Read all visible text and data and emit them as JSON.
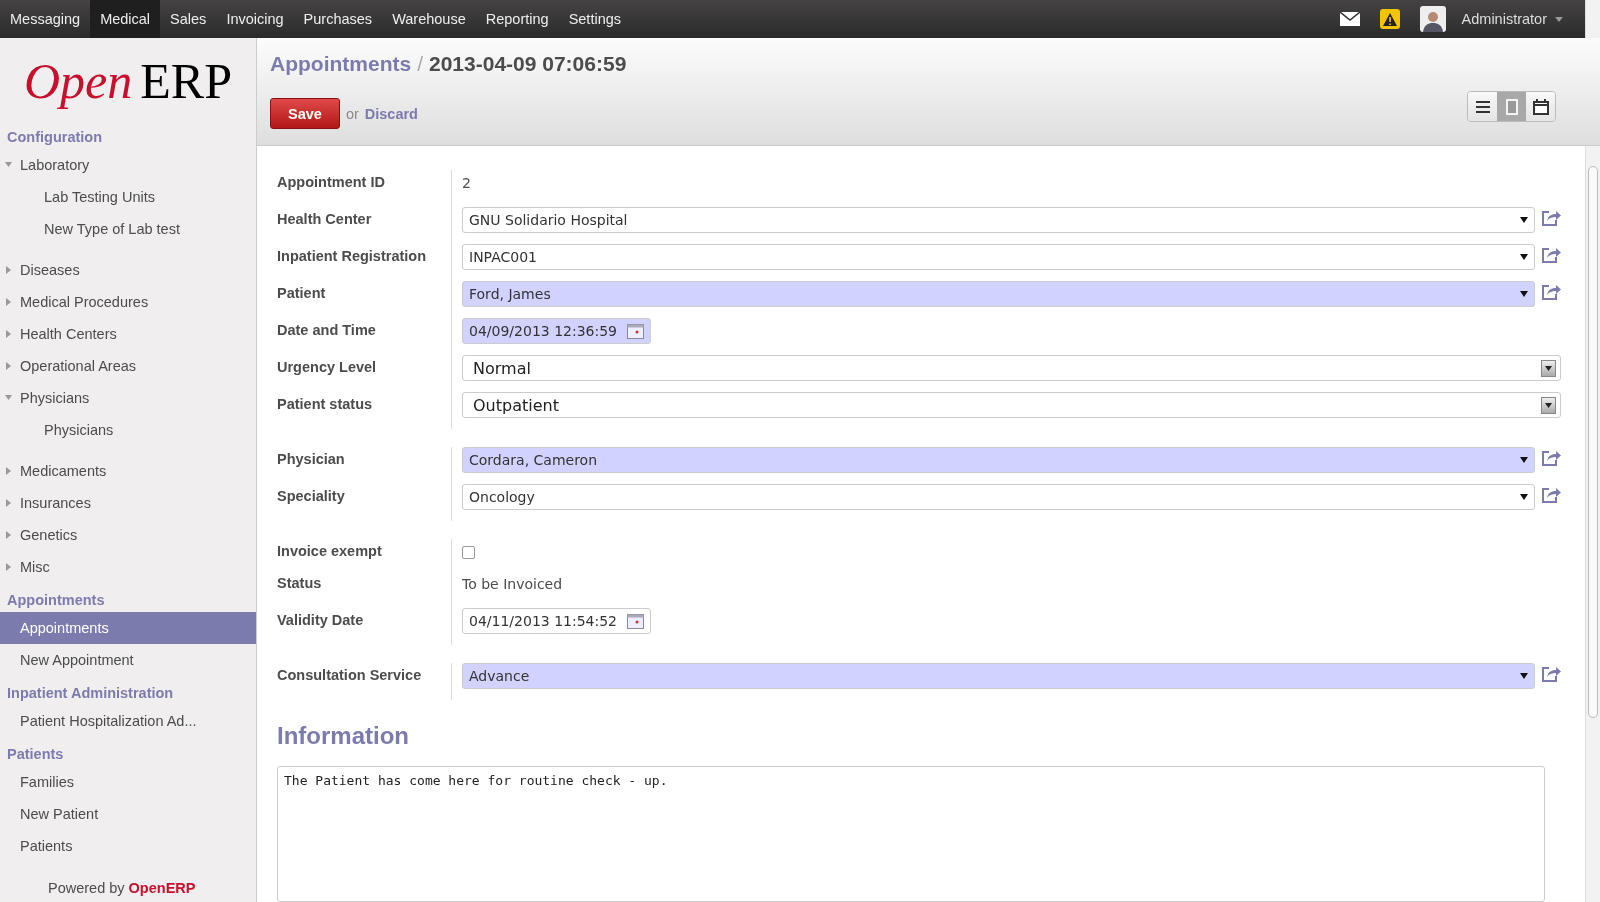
{
  "top_menu": [
    {
      "label": "Messaging",
      "selected": false
    },
    {
      "label": "Medical",
      "selected": true
    },
    {
      "label": "Sales",
      "selected": false
    },
    {
      "label": "Invoicing",
      "selected": false
    },
    {
      "label": "Purchases",
      "selected": false
    },
    {
      "label": "Warehouse",
      "selected": false
    },
    {
      "label": "Reporting",
      "selected": false
    },
    {
      "label": "Settings",
      "selected": false
    }
  ],
  "user": {
    "name": "Administrator"
  },
  "logo": {
    "open": "Open",
    "erp": "ERP"
  },
  "sidebar": {
    "sections": [
      {
        "title": "Configuration",
        "items": [
          {
            "label": "Laboratory",
            "expandable": true,
            "expanded": true,
            "selected": false,
            "children": [
              {
                "label": "Lab Testing Units",
                "selected": false
              },
              {
                "label": "New Type of Lab test",
                "selected": false
              }
            ]
          },
          {
            "label": "Diseases",
            "expandable": true,
            "expanded": false,
            "selected": false
          },
          {
            "label": "Medical Procedures",
            "expandable": true,
            "expanded": false,
            "selected": false
          },
          {
            "label": "Health Centers",
            "expandable": true,
            "expanded": false,
            "selected": false
          },
          {
            "label": "Operational Areas",
            "expandable": true,
            "expanded": false,
            "selected": false
          },
          {
            "label": "Physicians",
            "expandable": true,
            "expanded": true,
            "selected": false,
            "children": [
              {
                "label": "Physicians",
                "selected": false
              }
            ]
          },
          {
            "label": "Medicaments",
            "expandable": true,
            "expanded": false,
            "selected": false
          },
          {
            "label": "Insurances",
            "expandable": true,
            "expanded": false,
            "selected": false
          },
          {
            "label": "Genetics",
            "expandable": true,
            "expanded": false,
            "selected": false
          },
          {
            "label": "Misc",
            "expandable": true,
            "expanded": false,
            "selected": false
          }
        ]
      },
      {
        "title": "Appointments",
        "items": [
          {
            "label": "Appointments",
            "expandable": false,
            "selected": true
          },
          {
            "label": "New Appointment",
            "expandable": false,
            "selected": false
          }
        ]
      },
      {
        "title": "Inpatient Administration",
        "items": [
          {
            "label": "Patient Hospitalization Ad...",
            "expandable": false,
            "selected": false
          }
        ]
      },
      {
        "title": "Patients",
        "items": [
          {
            "label": "Families",
            "expandable": false,
            "selected": false
          },
          {
            "label": "New Patient",
            "expandable": false,
            "selected": false
          },
          {
            "label": "Patients",
            "expandable": false,
            "selected": false
          }
        ]
      }
    ],
    "footer": {
      "prefix": "Powered by",
      "brand": "OpenERP"
    }
  },
  "breadcrumb": {
    "parent": "Appointments",
    "separator": "/",
    "current": "2013-04-09 07:06:59"
  },
  "actions": {
    "save": "Save",
    "or": "or",
    "discard": "Discard"
  },
  "views": [
    {
      "kind": "list",
      "selected": false
    },
    {
      "kind": "form",
      "selected": true
    },
    {
      "kind": "calendar",
      "selected": false
    }
  ],
  "form_groups": [
    [
      {
        "label": "Appointment ID",
        "kind": "text",
        "value": "2"
      },
      {
        "label": "Health Center",
        "kind": "many2one",
        "value": "GNU Solidario Hospital",
        "required": false
      },
      {
        "label": "Inpatient Registration",
        "kind": "many2one",
        "value": "INPAC001",
        "required": false
      },
      {
        "label": "Patient",
        "kind": "many2one",
        "value": "Ford, James",
        "required": true
      },
      {
        "label": "Date and Time",
        "kind": "date",
        "value": "04/09/2013 12:36:59",
        "required": true
      },
      {
        "label": "Urgency Level",
        "kind": "select",
        "value": "Normal"
      },
      {
        "label": "Patient status",
        "kind": "select",
        "value": "Outpatient"
      }
    ],
    [
      {
        "label": "Physician",
        "kind": "many2one",
        "value": "Cordara, Cameron",
        "required": true
      },
      {
        "label": "Speciality",
        "kind": "many2one",
        "value": "Oncology",
        "required": false
      }
    ],
    [
      {
        "label": "Invoice exempt",
        "kind": "checkbox",
        "checked": false
      },
      {
        "label": "Status",
        "kind": "text",
        "value": "To be Invoiced"
      },
      {
        "label": "Validity Date",
        "kind": "date",
        "value": "04/11/2013 11:54:52",
        "required": false
      }
    ],
    [
      {
        "label": "Consultation Service",
        "kind": "many2one",
        "value": "Advance",
        "required": true
      }
    ]
  ],
  "information": {
    "title": "Information",
    "notes": "The Patient has come here for routine check - up."
  }
}
